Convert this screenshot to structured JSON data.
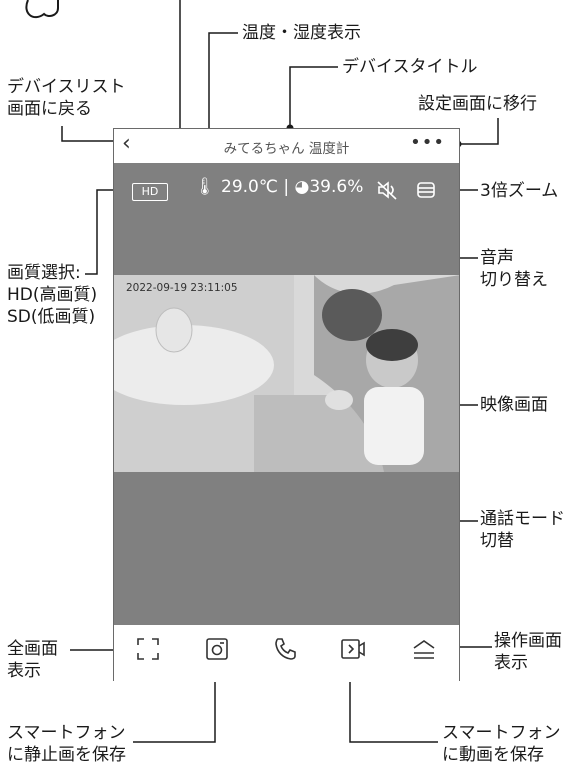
{
  "callouts": {
    "temp_humidity": "温度・湿度表示",
    "device_title": "デバイスタイトル",
    "back_to_list": "デバイスリスト\n画面に戻る",
    "to_settings": "設定画面に移行",
    "zoom": "3倍ズーム",
    "quality": "画質選択:\nHD(高画質)\nSD(低画質)",
    "audio": "音声\n切り替え",
    "video_screen": "映像画面",
    "talk_mode": "通話モード\n切替",
    "fullscreen": "全画面\n表示",
    "operation": "操作画面\n表示",
    "save_still": "スマートフォン\nに静止画を保存",
    "save_video": "スマートフォン\nに動画を保存"
  },
  "app": {
    "back_icon": "chevron-left-icon",
    "title": "みてるちゃん 温度計",
    "more_icon": "more-dots-icon",
    "quality_badge": "HD",
    "temperature": "29.0℃",
    "separator": "|",
    "humidity": "39.6%",
    "timestamp": "2022-09-19   23:11:05"
  },
  "colors": {
    "panel": "#808080",
    "border": "#6a6a6a"
  }
}
